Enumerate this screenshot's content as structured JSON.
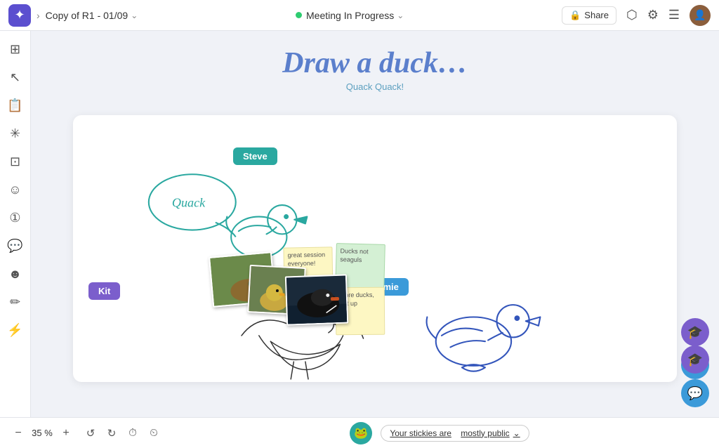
{
  "topbar": {
    "logo_symbol": "✦",
    "chevron_forward": "›",
    "title": "Copy of R1 - 01/09",
    "title_chevron": "⌄",
    "meeting_status": "Meeting In Progress",
    "meeting_chevron": "⌄",
    "share_label": "Share",
    "share_icon": "🔗",
    "template_icon": "⬡",
    "settings_icon": "⚙",
    "menu_icon": "☰"
  },
  "sidebar": {
    "items": [
      {
        "name": "frames-icon",
        "symbol": "⊞"
      },
      {
        "name": "cursor-icon",
        "symbol": "↖"
      },
      {
        "name": "notes-icon",
        "symbol": "📋"
      },
      {
        "name": "effects-icon",
        "symbol": "✳"
      },
      {
        "name": "template-icon",
        "symbol": "⊡"
      },
      {
        "name": "emoji-icon",
        "symbol": "☺"
      },
      {
        "name": "timer-icon",
        "symbol": "①"
      },
      {
        "name": "chat-icon",
        "symbol": "💬"
      },
      {
        "name": "face-icon",
        "symbol": "☻"
      },
      {
        "name": "pen-icon",
        "symbol": "✏"
      },
      {
        "name": "lightning-icon",
        "symbol": "⚡"
      }
    ]
  },
  "canvas": {
    "title": "Draw a duck…",
    "subtitle": "Quack Quack!"
  },
  "participants": {
    "steve": "Steve",
    "kit": "Kit",
    "jamie": "Jamie"
  },
  "stickies": [
    {
      "id": "s1",
      "text": "great session everyone!"
    },
    {
      "id": "s2",
      "text": "Ducks not seaguls"
    },
    {
      "id": "s3",
      "text": "more ducks, not up"
    }
  ],
  "bottombar": {
    "zoom_minus": "−",
    "zoom_value": "35 %",
    "zoom_plus": "+",
    "undo_icon": "↺",
    "redo_icon": "↻",
    "timer1": "⏱",
    "timer2": "⏲",
    "sticky_label": "Your stickies are",
    "mostly_public": "mostly public",
    "chevron": "⌄"
  }
}
